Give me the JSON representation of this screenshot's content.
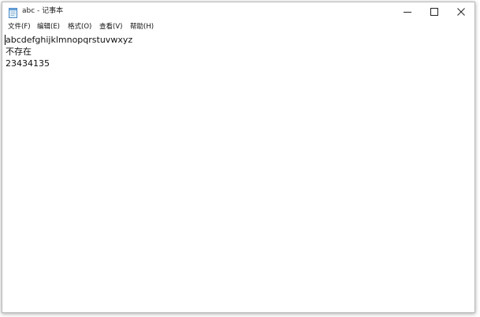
{
  "window": {
    "title": "abc - 记事本",
    "icon": "notepad-icon"
  },
  "titlebar_buttons": {
    "minimize_icon": "minimize-icon",
    "maximize_icon": "maximize-icon",
    "close_icon": "close-icon"
  },
  "menu": {
    "items": [
      {
        "label": "文件(F)"
      },
      {
        "label": "编辑(E)"
      },
      {
        "label": "格式(O)"
      },
      {
        "label": "查看(V)"
      },
      {
        "label": "帮助(H)"
      }
    ]
  },
  "document": {
    "lines": [
      "abcdefghijklmnopqrstuvwxyz",
      "不存在",
      "23434135"
    ]
  },
  "colors": {
    "window_border": "#b9b9b9",
    "text": "#111111",
    "background": "#ffffff"
  }
}
